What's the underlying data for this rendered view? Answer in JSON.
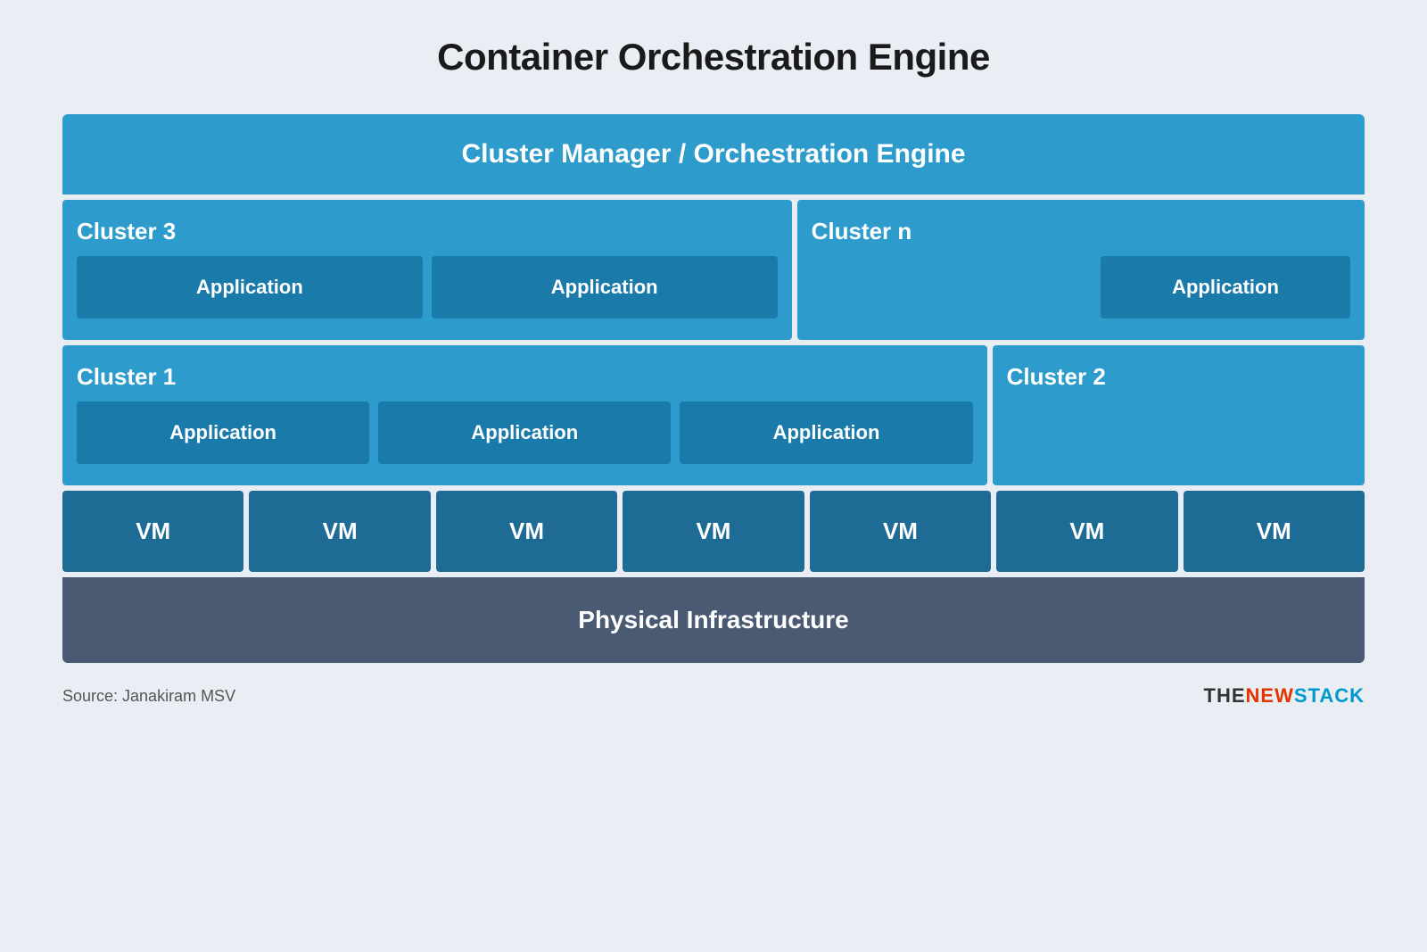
{
  "title": "Container Orchestration Engine",
  "diagram": {
    "cluster_manager_label": "Cluster Manager / Orchestration Engine",
    "cluster3": {
      "label": "Cluster 3",
      "apps": [
        "Application",
        "Application"
      ]
    },
    "clustern": {
      "label": "Cluster n",
      "app": "Application"
    },
    "cluster1": {
      "label": "Cluster 1",
      "apps": [
        "Application",
        "Application",
        "Application"
      ]
    },
    "cluster2": {
      "label": "Cluster 2"
    },
    "vms": [
      "VM",
      "VM",
      "VM",
      "VM",
      "VM",
      "VM",
      "VM"
    ],
    "physical_label": "Physical Infrastructure"
  },
  "footer": {
    "source": "Source: Janakiram MSV",
    "brand_the": "THE",
    "brand_new": "NEW",
    "brand_stack": "STACK"
  }
}
